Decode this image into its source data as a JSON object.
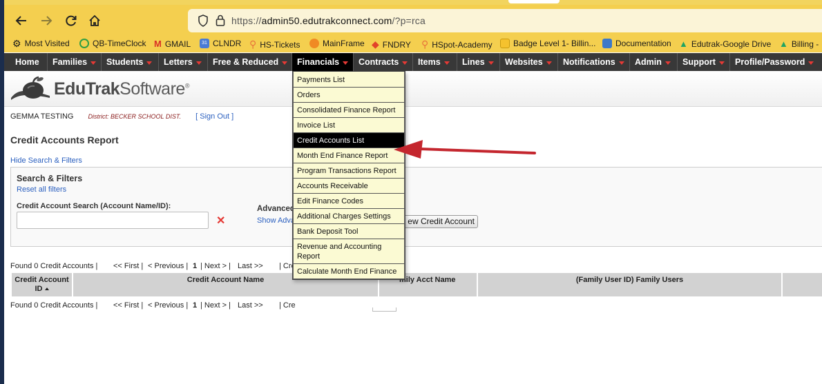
{
  "browser": {
    "url_prefix": "https://",
    "url_host": "admin50.edutrakconnect.com",
    "url_path": "/?p=rca",
    "bookmarks": [
      {
        "label": "Most Visited",
        "icon": "gear-icon"
      },
      {
        "label": "QB-TimeClock",
        "icon": "clock-icon"
      },
      {
        "label": "GMAIL",
        "icon": "gmail-icon"
      },
      {
        "label": "CLNDR",
        "icon": "calendar-icon"
      },
      {
        "label": "HS-Tickets",
        "icon": "hubspot-icon"
      },
      {
        "label": "MainFrame",
        "icon": "mainframe-icon"
      },
      {
        "label": "FNDRY",
        "icon": "gitlab-icon"
      },
      {
        "label": "HSpot-Academy",
        "icon": "hubspot-icon"
      },
      {
        "label": "Badge Level 1- Billin...",
        "icon": "badge-icon"
      },
      {
        "label": "Documentation",
        "icon": "stack-icon"
      },
      {
        "label": "Edutrak-Google Drive",
        "icon": "drive-icon"
      },
      {
        "label": "Billing -",
        "icon": "drive-icon"
      }
    ]
  },
  "nav": {
    "items": [
      "Home",
      "Families",
      "Students",
      "Letters",
      "Free & Reduced",
      "Financials",
      "Contracts",
      "Items",
      "Lines",
      "Websites",
      "Notifications",
      "Admin",
      "Support",
      "Profile/Password"
    ],
    "active": "Financials"
  },
  "header": {
    "logo_bold": "EduTrak",
    "logo_light": "Software",
    "logo_mark": "®"
  },
  "user": {
    "name": "GEMMA TESTING",
    "district": "District: BECKER SCHOOL DIST.",
    "signout": "[ Sign Out ]"
  },
  "page": {
    "title": "Credit Accounts Report",
    "hide_filters": "Hide Search & Filters"
  },
  "filters": {
    "title": "Search & Filters",
    "reset": "Reset all filters",
    "search_label": "Credit Account Search (Account Name/ID):",
    "search_value": "",
    "clear": "✕",
    "advanced": "Advanced",
    "show_advanced": "Show Adva",
    "new_button": "ew Credit Account"
  },
  "pager": {
    "found": "Found 0 Credit Accounts |",
    "first": "<< First |",
    "previous": "< Previous |",
    "page": "1",
    "next": "|  Next > |",
    "last": "Last >>",
    "cr_top": "| Cre",
    "cr_bottom": "| Cre"
  },
  "table": {
    "columns": [
      "Credit Account ID",
      "Credit Account Name",
      "",
      "mily Acct Name",
      "(Family User ID) Family Users",
      ""
    ],
    "col0_line1": "Credit Account",
    "col0_line2": "ID"
  },
  "dropdown": {
    "items": [
      "Payments List",
      "Orders",
      "Consolidated Finance Report",
      "Invoice List",
      "Credit Accounts List",
      "Month End Finance Report",
      "Program Transactions Report",
      "Accounts Receivable",
      "Edit Finance Codes",
      "Additional Charges Settings",
      "Bank Deposit Tool",
      "Revenue and Accounting Report",
      "Calculate Month End Finance"
    ],
    "selected": "Credit Accounts List"
  },
  "colors": {
    "browser_toolbar": "#f4cf4f",
    "nav_bg": "#383838",
    "nav_caret": "#e53935",
    "menu_bg": "#fbfad3",
    "link": "#2a5fbf",
    "arrow": "#c4262e"
  }
}
